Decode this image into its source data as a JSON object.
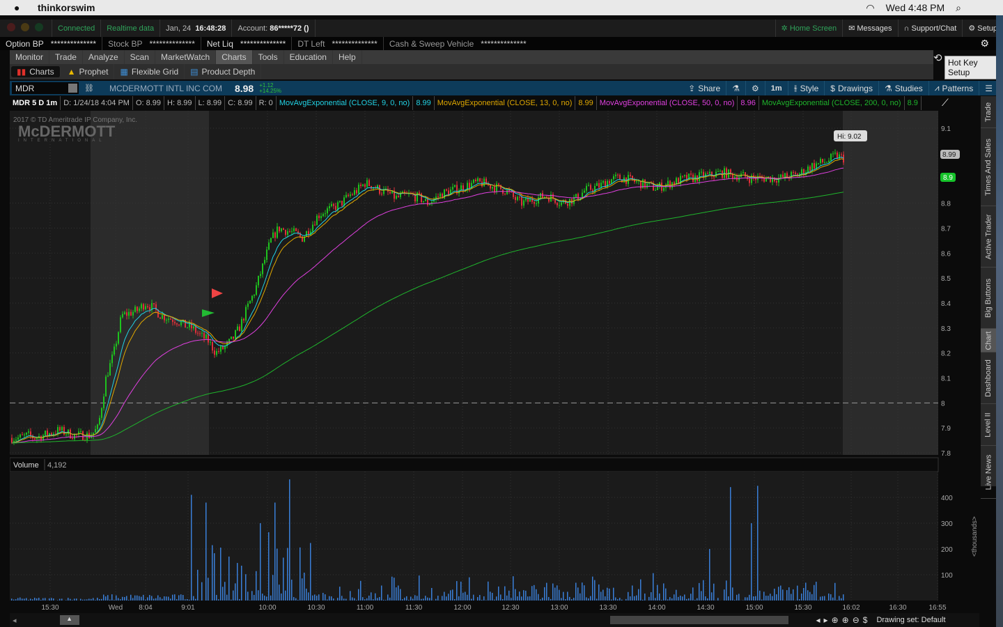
{
  "menubar": {
    "app": "thinkorswim",
    "clock": "Wed 4:48 PM"
  },
  "status": {
    "connected": "Connected",
    "realtime": "Realtime data",
    "date": "Jan, 24",
    "time": "16:48:28",
    "account_label": "Account:",
    "account": "86*****72 ()"
  },
  "top_links": [
    {
      "label": "Home Screen"
    },
    {
      "label": "Messages"
    },
    {
      "label": "Support/Chat"
    },
    {
      "label": "Setup"
    }
  ],
  "balances": [
    {
      "label": "Option BP",
      "value": "**************"
    },
    {
      "label": "Stock BP",
      "value": "**************"
    },
    {
      "label": "Net Liq",
      "value": "**************"
    },
    {
      "label": "DT Left",
      "value": "**************"
    },
    {
      "label": "Cash & Sweep Vehicle",
      "value": "**************"
    }
  ],
  "main_tabs": [
    "Monitor",
    "Trade",
    "Analyze",
    "Scan",
    "MarketWatch",
    "Charts",
    "Tools",
    "Education",
    "Help"
  ],
  "sub_tabs": [
    "Charts",
    "Prophet",
    "Flexible Grid",
    "Product Depth"
  ],
  "tooltip": "Hot Key Setup",
  "symbol": {
    "ticker": "MDR",
    "name": "MCDERMOTT INTL INC COM",
    "last": "8.98",
    "change": "+1.12",
    "change_pct": "+14.25%"
  },
  "chart_tools": [
    "Share",
    "1m",
    "Style",
    "Drawings",
    "Studies",
    "Patterns"
  ],
  "legend": {
    "title": "MDR 5 D 1m",
    "date": "D: 1/24/18 4:04 PM",
    "open": "O: 8.99",
    "high": "H: 8.99",
    "low": "L: 8.99",
    "close": "C: 8.99",
    "range": "R: 0",
    "studies": [
      {
        "label": "MovAvgExponential (CLOSE, 9, 0, no)",
        "value": "8.99",
        "color": "#22d3e6"
      },
      {
        "label": "MovAvgExponential (CLOSE, 13, 0, no)",
        "value": "8.99",
        "color": "#e0a800"
      },
      {
        "label": "MovAvgExponential (CLOSE, 50, 0, no)",
        "value": "8.96",
        "color": "#e040e0"
      },
      {
        "label": "MovAvgExponential (CLOSE, 200, 0, no)",
        "value": "8.9",
        "color": "#1fb52c"
      }
    ]
  },
  "watermark": {
    "copyright": "2017 © TD Ameritrade IP Company, Inc.",
    "logo": "McDERMOTT",
    "logo_sub": "INTERNATIONAL"
  },
  "vertical_tabs": [
    "Trade",
    "Times And Sales",
    "Active Trader",
    "Big Buttons",
    "Chart",
    "Dashboard",
    "Level II",
    "Live News"
  ],
  "volume": {
    "label": "Volume",
    "value": "4,192",
    "unit": "<thousands>"
  },
  "bottom": {
    "drawing_set": "Drawing set: Default"
  },
  "chart_data": {
    "type": "candlestick",
    "price_axis": {
      "min": 7.8,
      "max": 9.1,
      "ticks": [
        "9.1",
        "8.9",
        "8.8",
        "8.7",
        "8.6",
        "8.5",
        "8.4",
        "8.3",
        "8.2",
        "8.1",
        "8",
        "7.9",
        "7.8"
      ]
    },
    "price_markers": {
      "hi": "Hi: 9.02",
      "last": "8.99",
      "ema200": "8.9"
    },
    "prev_close": 8.0,
    "x_ticks": [
      "15:30",
      "Wed",
      "8:04",
      "9:01",
      "10:00",
      "10:30",
      "11:00",
      "11:30",
      "12:00",
      "12:30",
      "13:00",
      "13:30",
      "14:00",
      "14:30",
      "15:00",
      "15:30",
      "16:02",
      "16:30",
      "16:55"
    ],
    "closes": [
      7.86,
      7.86,
      7.87,
      7.86,
      7.87,
      7.88,
      7.89,
      7.88,
      7.87,
      7.87,
      7.87,
      7.9,
      8.1,
      8.2,
      8.35,
      8.36,
      8.37,
      8.4,
      8.38,
      8.35,
      8.34,
      8.33,
      8.31,
      8.3,
      8.27,
      8.25,
      8.2,
      8.22,
      8.25,
      8.3,
      8.38,
      8.45,
      8.55,
      8.65,
      8.7,
      8.69,
      8.68,
      8.66,
      8.7,
      8.75,
      8.77,
      8.78,
      8.8,
      8.83,
      8.85,
      8.88,
      8.87,
      8.85,
      8.84,
      8.82,
      8.83,
      8.83,
      8.82,
      8.8,
      8.82,
      8.84,
      8.85,
      8.86,
      8.87,
      8.88,
      8.88,
      8.87,
      8.86,
      8.85,
      8.82,
      8.8,
      8.81,
      8.82,
      8.83,
      8.82,
      8.8,
      8.81,
      8.82,
      8.85,
      8.86,
      8.87,
      8.89,
      8.9,
      8.9,
      8.89,
      8.88,
      8.87,
      8.86,
      8.87,
      8.88,
      8.89,
      8.9,
      8.9,
      8.91,
      8.91,
      8.92,
      8.92,
      8.91,
      8.91,
      8.9,
      8.9,
      8.9,
      8.9,
      8.9,
      8.91,
      8.91,
      8.93,
      8.95,
      8.96,
      8.97,
      8.99,
      8.98
    ],
    "volume_axis": {
      "min": 0,
      "max": 450,
      "ticks": [
        400,
        300,
        200,
        100
      ]
    },
    "volume_spikes_k": [
      {
        "at": 0.215,
        "v": 410
      },
      {
        "at": 0.234,
        "v": 380
      },
      {
        "at": 0.26,
        "v": 350
      },
      {
        "at": 0.316,
        "v": 380
      },
      {
        "at": 0.335,
        "v": 470
      },
      {
        "at": 0.3,
        "v": 300
      },
      {
        "at": 0.84,
        "v": 200
      },
      {
        "at": 0.865,
        "v": 440
      },
      {
        "at": 0.897,
        "v": 445
      },
      {
        "at": 0.89,
        "v": 300
      }
    ]
  }
}
